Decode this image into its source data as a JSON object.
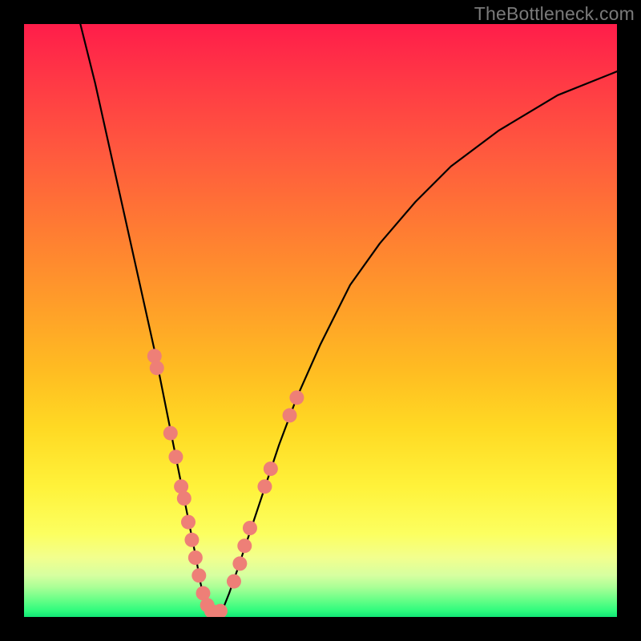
{
  "watermark_text": "TheBottleneck.com",
  "chart_data": {
    "type": "line",
    "title": "",
    "xlabel": "",
    "ylabel": "",
    "xlim": [
      0,
      100
    ],
    "ylim": [
      0,
      100
    ],
    "grid": false,
    "legend": false,
    "background_gradient": {
      "top_color": "#ff1d4a",
      "bottom_color": "#12e676"
    },
    "series": [
      {
        "name": "bottleneck-curve",
        "x": [
          9.5,
          12,
          14,
          16,
          18,
          20,
          22,
          23,
          24,
          25,
          26,
          27,
          28,
          29,
          29.7,
          30.4,
          31,
          32,
          33.4,
          34.6,
          36,
          38,
          40,
          43,
          46,
          50,
          55,
          60,
          66,
          72,
          80,
          90,
          100
        ],
        "y": [
          100,
          90,
          81,
          72,
          63,
          54,
          45,
          40,
          35,
          30,
          25,
          20,
          15,
          10,
          6,
          3,
          1,
          0,
          1,
          4,
          8,
          14,
          20,
          29,
          37,
          46,
          56,
          63,
          70,
          76,
          82,
          88,
          92
        ],
        "color": "#000000"
      }
    ],
    "annotations_scatter": {
      "name": "highlight-dots",
      "color": "#ee7f77",
      "points": [
        {
          "x": 22.0,
          "y": 44
        },
        {
          "x": 22.4,
          "y": 42
        },
        {
          "x": 24.7,
          "y": 31
        },
        {
          "x": 25.6,
          "y": 27
        },
        {
          "x": 26.5,
          "y": 22
        },
        {
          "x": 27.0,
          "y": 20
        },
        {
          "x": 27.7,
          "y": 16
        },
        {
          "x": 28.3,
          "y": 13
        },
        {
          "x": 28.9,
          "y": 10
        },
        {
          "x": 29.5,
          "y": 7
        },
        {
          "x": 30.2,
          "y": 4
        },
        {
          "x": 30.9,
          "y": 2
        },
        {
          "x": 31.6,
          "y": 1
        },
        {
          "x": 32.3,
          "y": 0.5
        },
        {
          "x": 33.1,
          "y": 1
        },
        {
          "x": 35.4,
          "y": 6
        },
        {
          "x": 36.4,
          "y": 9
        },
        {
          "x": 37.2,
          "y": 12
        },
        {
          "x": 38.1,
          "y": 15
        },
        {
          "x": 40.6,
          "y": 22
        },
        {
          "x": 41.6,
          "y": 25
        },
        {
          "x": 44.8,
          "y": 34
        },
        {
          "x": 46.0,
          "y": 37
        }
      ]
    }
  }
}
